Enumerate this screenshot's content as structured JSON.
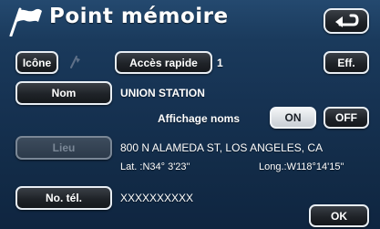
{
  "header": {
    "title": "Point mémoire",
    "back_icon": "back-arrow-icon",
    "flag_icon": "flag-icon"
  },
  "row1": {
    "icon_button_label": "Icône",
    "quick_access_label": "Accès rapide",
    "quick_access_value": "1",
    "delete_button_label": "Eff."
  },
  "name": {
    "button_label": "Nom",
    "value": "UNION STATION"
  },
  "display_names": {
    "label": "Affichage noms",
    "on_label": "ON",
    "off_label": "OFF",
    "selected": "ON"
  },
  "location": {
    "button_label": "Lieu",
    "address": "800 N ALAMEDA ST, LOS ANGELES, CA",
    "lat": "Lat. :N34° 3'23\"",
    "long": "Long.:W118°14'15\""
  },
  "phone": {
    "button_label": "No. tél.",
    "value": "XXXXXXXXXX"
  },
  "footer": {
    "ok_label": "OK"
  },
  "colors": {
    "background": "#163252",
    "button_border": "#e8eef4",
    "active_button": "#e0e4e8"
  }
}
